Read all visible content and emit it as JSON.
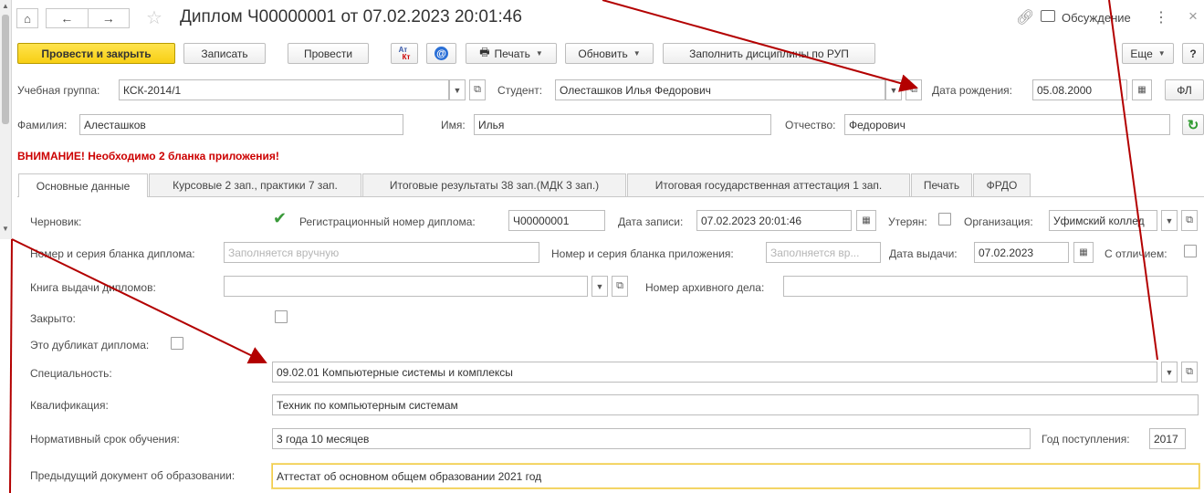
{
  "window": {
    "title": "Диплом Ч00000001 от 07.02.2023 20:01:46",
    "discussion_label": "Обсуждение",
    "more_icon": "⋮",
    "close_icon": "×"
  },
  "toolbar": {
    "post_close": "Провести и закрыть",
    "save": "Записать",
    "post": "Провести",
    "print": "Печать",
    "refresh": "Обновить",
    "fill_disciplines": "Заполнить дисциплины по РУП",
    "more": "Еще",
    "help": "?",
    "dt_kt_top": "Ат",
    "dt_kt_bottom": "Кт"
  },
  "header": {
    "group_label": "Учебная группа:",
    "group_value": "КСК-2014/1",
    "student_label": "Студент:",
    "student_value": "Олесташков Илья Федорович",
    "birth_label": "Дата рождения:",
    "birth_value": "05.08.2000",
    "fl_label": "ФЛ",
    "surname_label": "Фамилия:",
    "surname_value": "Алесташков",
    "name_label": "Имя:",
    "name_value": "Илья",
    "patronymic_label": "Отчество:",
    "patronymic_value": "Федорович",
    "warning": "ВНИМАНИЕ! Необходимо 2 бланка приложения!"
  },
  "tabs": [
    {
      "label": "Основные данные"
    },
    {
      "label": "Курсовые 2 зап., практики 7 зап."
    },
    {
      "label": "Итоговые результаты 38 зап.(МДК 3 зап.)"
    },
    {
      "label": "Итоговая государственная аттестация 1 зап."
    },
    {
      "label": "Печать"
    },
    {
      "label": "ФРДО"
    }
  ],
  "form": {
    "draft_label": "Черновик:",
    "reg_number_label": "Регистрационный номер диплома:",
    "reg_number_value": "Ч00000001",
    "record_date_label": "Дата записи:",
    "record_date_value": "07.02.2023 20:01:46",
    "lost_label": "Утерян:",
    "org_label": "Организация:",
    "org_value": "Уфимский коллед",
    "blank_label": "Номер и серия бланка диплома:",
    "blank_placeholder": "Заполняется вручную",
    "appendix_label": "Номер и серия бланка приложения:",
    "appendix_placeholder": "Заполняется вр...",
    "issue_date_label": "Дата выдачи:",
    "issue_date_value": "07.02.2023",
    "honors_label": "С отличием:",
    "book_label": "Книга выдачи дипломов:",
    "archive_label": "Номер архивного дела:",
    "closed_label": "Закрыто:",
    "duplicate_label": "Это дубликат диплома:",
    "specialty_label": "Специальность:",
    "specialty_value": "09.02.01   Компьютерные системы и комплексы",
    "qualification_label": "Квалификация:",
    "qualification_value": "Техник по компьютерным системам",
    "term_label": "Нормативный срок обучения:",
    "term_value": "3 года 10 месяцев",
    "year_label": "Год поступления:",
    "year_value": "2017",
    "prev_doc_label": "Предыдущий документ об образовании:",
    "prev_doc_value": "Аттестат об основном общем образовании 2021 год"
  },
  "colors": {
    "accent_yellow": "#f7cf14",
    "warning_red": "#cc0000",
    "arrow_red": "#b30000",
    "checkmark_green": "#3a9a3a"
  }
}
